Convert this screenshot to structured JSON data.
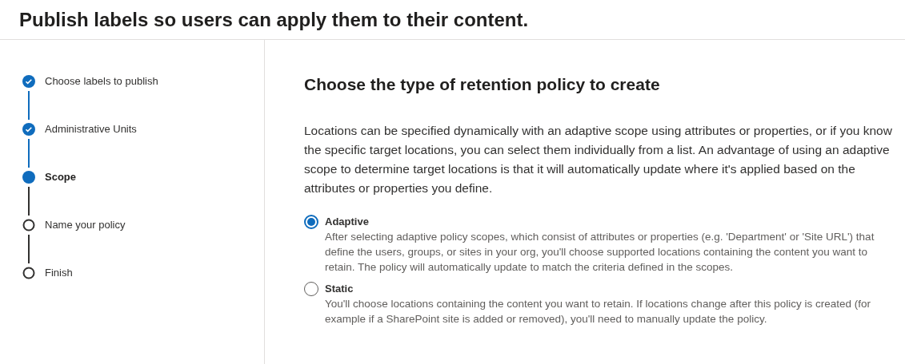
{
  "page_title": "Publish labels so users can apply them to their content.",
  "steps": [
    {
      "label": "Choose labels to publish",
      "kind": "done"
    },
    {
      "label": "Administrative Units",
      "kind": "done"
    },
    {
      "label": "Scope",
      "kind": "current"
    },
    {
      "label": "Name your policy",
      "kind": "pending"
    },
    {
      "label": "Finish",
      "kind": "pending"
    }
  ],
  "heading": "Choose the type of retention policy to create",
  "intro": "Locations can be specified dynamically with an adaptive scope using attributes or properties, or if you know the specific target locations, you can select them individually from a list. An advantage of using an adaptive scope to determine target locations is that it will automatically update where it's applied based on the attributes or properties you define.",
  "options": [
    {
      "label": "Adaptive",
      "selected": true,
      "description": "After selecting adaptive policy scopes, which consist of attributes or properties (e.g. 'Department' or 'Site URL') that define the users, groups, or sites in your org, you'll choose supported locations containing the content you want to retain. The policy will automatically update to match the criteria defined in the scopes."
    },
    {
      "label": "Static",
      "selected": false,
      "description": "You'll choose locations containing the content you want to retain. If locations change after this policy is created (for example if a SharePoint site is added or removed), you'll need to manually update the policy."
    }
  ]
}
